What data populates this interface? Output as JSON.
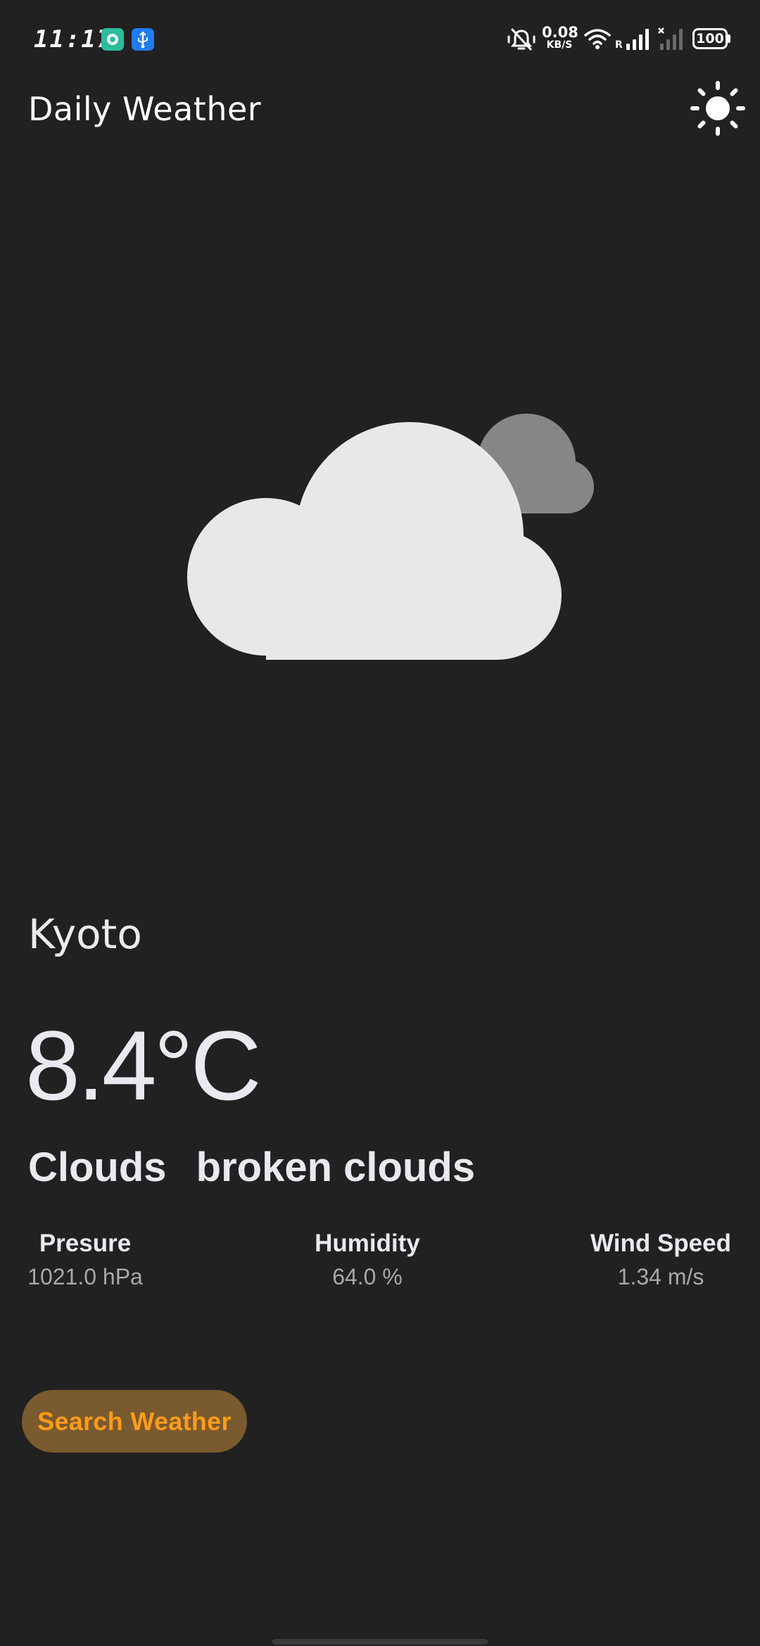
{
  "status_bar": {
    "time": "11:17",
    "net_speed_value": "0.08",
    "net_speed_unit": "KB/S",
    "battery": "100",
    "roaming_label": "R",
    "icons": [
      "chat-app-icon",
      "usb-icon",
      "mute-icon",
      "wifi-icon",
      "signal-icon",
      "signal-no-service-icon",
      "battery-icon"
    ]
  },
  "app_bar": {
    "title": "Daily Weather",
    "theme_icon": "sun-icon"
  },
  "weather": {
    "illustration": "cloud-with-grey-cloud",
    "city": "Kyoto",
    "temperature": "8.4°C",
    "main": "Clouds",
    "description": "broken clouds",
    "stats": {
      "pressure": {
        "label": "Presure",
        "value": "1021.0 hPa"
      },
      "humidity": {
        "label": "Humidity",
        "value": "64.0 %"
      },
      "wind": {
        "label": "Wind Speed",
        "value": "1.34 m/s"
      }
    }
  },
  "actions": {
    "search_label": "Search Weather"
  },
  "colors": {
    "background": "#212121",
    "accent": "#ff9c1a",
    "button_bg": "#7a5a2f",
    "cloud_front": "#e8e8e8",
    "cloud_back": "#868686"
  }
}
